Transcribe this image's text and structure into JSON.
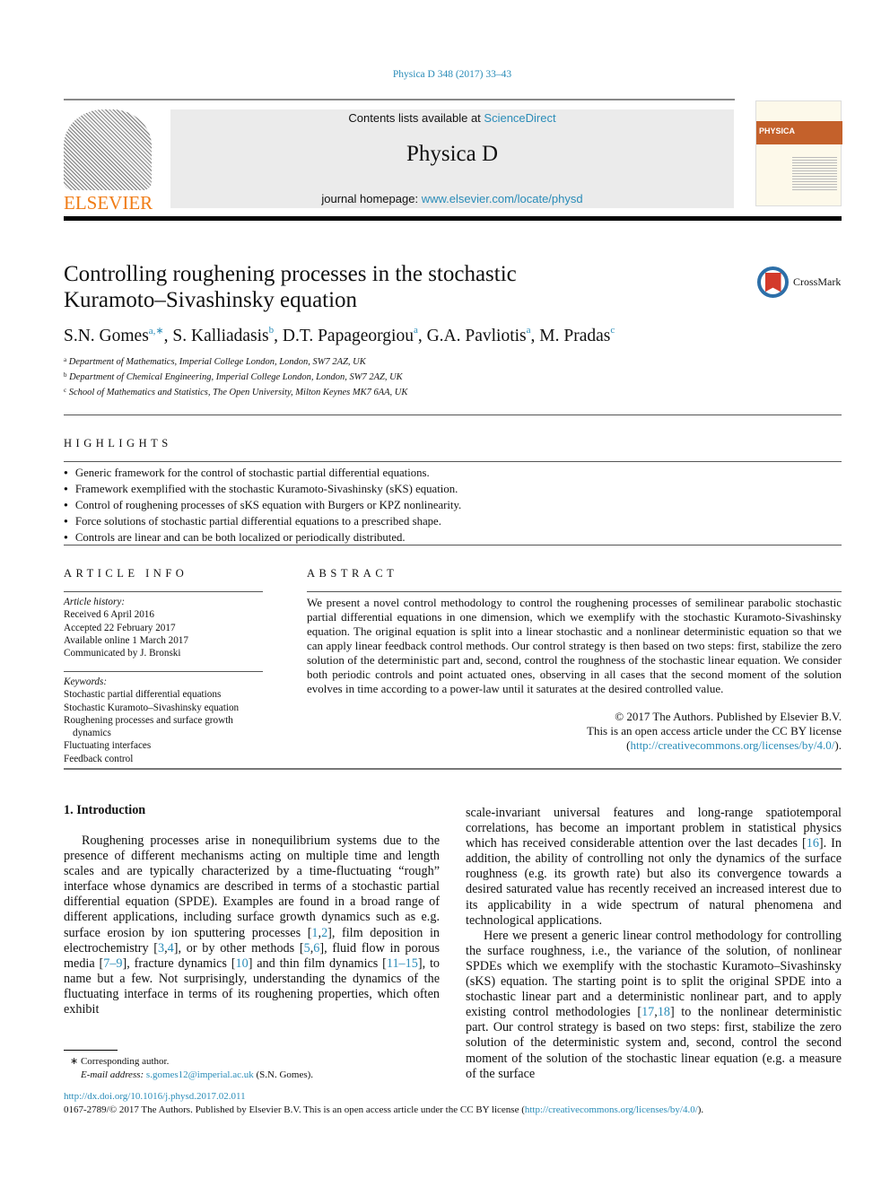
{
  "journal_ref": "Physica D 348 (2017) 33–43",
  "header": {
    "contents_prefix": "Contents lists available at ",
    "sciencedirect": "ScienceDirect",
    "journal": "Physica D",
    "homepage_prefix": "journal homepage: ",
    "homepage_url": "www.elsevier.com/locate/physd",
    "publisher_logo": "ELSEVIER",
    "cover_label": "PHYSICA"
  },
  "title_lines": [
    "Controlling roughening processes in the stochastic",
    "Kuramoto–Sivashinsky equation"
  ],
  "crossmark": "CrossMark",
  "authors": [
    {
      "name": "S.N. Gomes",
      "sup": "a,∗"
    },
    {
      "name": "S. Kalliadasis",
      "sup": "b"
    },
    {
      "name": "D.T. Papageorgiou",
      "sup": "a"
    },
    {
      "name": "G.A. Pavliotis",
      "sup": "a"
    },
    {
      "name": "M. Pradas",
      "sup": "c"
    }
  ],
  "affiliations": [
    {
      "sup": "a",
      "text": "Department of Mathematics, Imperial College London, London, SW7 2AZ, UK"
    },
    {
      "sup": "b",
      "text": "Department of Chemical Engineering, Imperial College London, London, SW7 2AZ, UK"
    },
    {
      "sup": "c",
      "text": "School of Mathematics and Statistics, The Open University, Milton Keynes MK7 6AA, UK"
    }
  ],
  "highlights": {
    "heading": "HIGHLIGHTS",
    "items": [
      "Generic framework for the control of stochastic partial differential equations.",
      "Framework exemplified with the stochastic Kuramoto-Sivashinsky (sKS) equation.",
      "Control of roughening processes of sKS equation with Burgers or KPZ nonlinearity.",
      "Force solutions of stochastic partial differential equations to a prescribed shape.",
      "Controls are linear and can be both localized or periodically distributed."
    ]
  },
  "article_info": {
    "heading": "ARTICLE INFO",
    "history_label": "Article history:",
    "history": [
      "Received 6 April 2016",
      "Accepted 22 February 2017",
      "Available online 1 March 2017",
      "Communicated by J. Bronski"
    ],
    "keywords_label": "Keywords:",
    "keywords": [
      "Stochastic partial differential equations",
      "Stochastic Kuramoto–Sivashinsky equation",
      "Roughening processes and surface growth",
      "dynamics",
      "Fluctuating interfaces",
      "Feedback control"
    ]
  },
  "abstract": {
    "heading": "ABSTRACT",
    "text": "We present a novel control methodology to control the roughening processes of semilinear parabolic stochastic partial differential equations in one dimension, which we exemplify with the stochastic Kuramoto-Sivashinsky equation. The original equation is split into a linear stochastic and a nonlinear deterministic equation so that we can apply linear feedback control methods. Our control strategy is then based on two steps: first, stabilize the zero solution of the deterministic part and, second, control the roughness of the stochastic linear equation. We consider both periodic controls and point actuated ones, observing in all cases that the second moment of the solution evolves in time according to a power-law until it saturates at the desired controlled value.",
    "copyright_lines": [
      "© 2017 The Authors. Published by Elsevier B.V.",
      "This is an open access article under the CC BY license"
    ],
    "license_url": "http://creativecommons.org/licenses/by/4.0/"
  },
  "intro": {
    "heading": "1.  Introduction",
    "left": [
      [
        "Roughening processes arise in nonequilibrium systems due to the presence of different mechanisms acting on multiple time and length scales and are typically characterized by a time-fluctuating “rough” interface whose dynamics are described in terms of a stochastic partial differential equation (SPDE). Examples are found in a broad range of different applications, including surface growth dynamics such as e.g. surface erosion by ion sputtering processes [",
        {
          "l": "1"
        },
        ",",
        {
          "l": "2"
        },
        "], film deposition in electrochemistry [",
        {
          "l": "3"
        },
        ",",
        {
          "l": "4"
        },
        "], or by other methods [",
        {
          "l": "5"
        },
        ",",
        {
          "l": "6"
        },
        "], fluid flow in porous media [",
        {
          "l": "7–9"
        },
        "], fracture dynamics [",
        {
          "l": "10"
        },
        "] and thin film dynamics [",
        {
          "l": "11–15"
        },
        "], to name but a few. Not surprisingly, understanding the dynamics of the fluctuating interface in terms of its roughening properties, which often exhibit"
      ]
    ],
    "right": [
      [
        "scale-invariant universal features and long-range spatiotemporal correlations, has become an important problem in statistical physics which has received considerable attention over the last decades [",
        {
          "l": "16"
        },
        "]. In addition, the ability of controlling not only the dynamics of the surface roughness (e.g. its growth rate) but also its convergence towards a desired saturated value has recently received an increased interest due to its applicability in a wide spectrum of natural phenomena and technological applications."
      ],
      [
        "Here we present a generic linear control methodology for controlling the surface roughness, i.e., the variance of the solution, of nonlinear SPDEs which we exemplify with the stochastic Kuramoto–Sivashinsky (sKS) equation. The starting point is to split the original SPDE into a stochastic linear part and a deterministic nonlinear part, and to apply existing control methodologies [",
        {
          "l": "17"
        },
        ",",
        {
          "l": "18"
        },
        "] to the nonlinear deterministic part. Our control strategy is based on two steps: first, stabilize the zero solution of the deterministic system and, second, control the second moment of the solution of the stochastic linear equation (e.g. a measure of the surface"
      ]
    ]
  },
  "footnote": {
    "mark": "∗",
    "text": "Corresponding author.",
    "email_label": "E-mail address: ",
    "email": "s.gomes12@imperial.ac.uk",
    "email_suffix": " (S.N. Gomes)."
  },
  "doi": "http://dx.doi.org/10.1016/j.physd.2017.02.011",
  "issn_line": "0167-2789/© 2017 The Authors. Published by Elsevier B.V. This is an open access article under the CC BY license (",
  "issn_url": "http://creativecommons.org/licenses/by/4.0/",
  "issn_suffix": ")."
}
